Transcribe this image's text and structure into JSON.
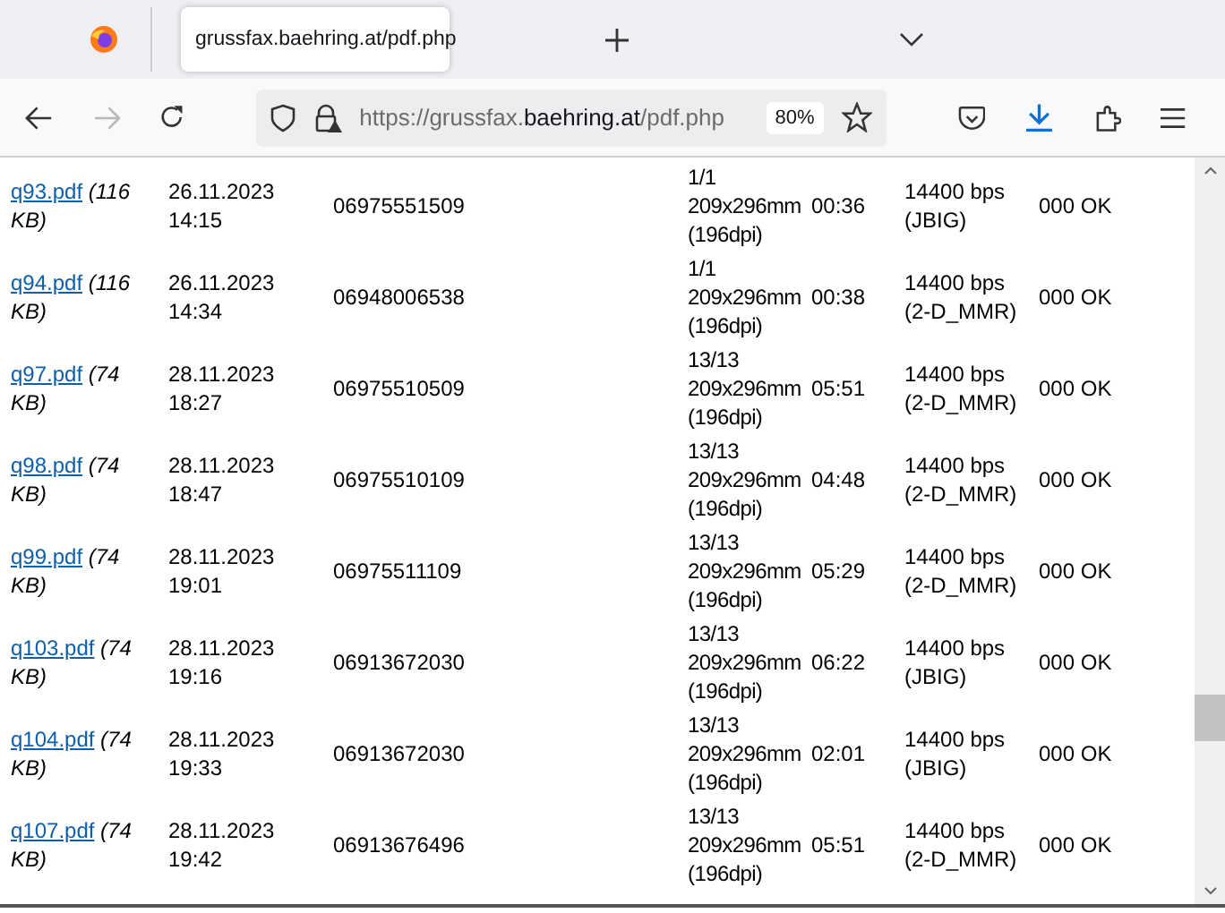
{
  "browser": {
    "tab": {
      "title": "grussfax.baehring.at/pdf.php",
      "selected": true
    },
    "url": {
      "scheme": "https://grussfax.",
      "domain": "baehring.at",
      "path": "/pdf.php"
    },
    "zoom": "80%",
    "forward_disabled": true
  },
  "rows": [
    {
      "file": "q93.pdf",
      "size": "(116 KB)",
      "date": "26.11.2023 14:15",
      "number": "06975551509",
      "pages": "1/1 209x296mm (196dpi)",
      "duration": "00:36",
      "speed": "14400 bps (JBIG)",
      "status": "000 OK"
    },
    {
      "file": "q94.pdf",
      "size": "(116 KB)",
      "date": "26.11.2023 14:34",
      "number": "06948006538",
      "pages": "1/1 209x296mm (196dpi)",
      "duration": "00:38",
      "speed": "14400 bps (2-D_MMR)",
      "status": "000 OK"
    },
    {
      "file": "q97.pdf",
      "size": "(74 KB)",
      "date": "28.11.2023 18:27",
      "number": "06975510509",
      "pages": "13/13 209x296mm (196dpi)",
      "duration": "05:51",
      "speed": "14400 bps (2-D_MMR)",
      "status": "000 OK"
    },
    {
      "file": "q98.pdf",
      "size": "(74 KB)",
      "date": "28.11.2023 18:47",
      "number": "06975510109",
      "pages": "13/13 209x296mm (196dpi)",
      "duration": "04:48",
      "speed": "14400 bps (2-D_MMR)",
      "status": "000 OK"
    },
    {
      "file": "q99.pdf",
      "size": "(74 KB)",
      "date": "28.11.2023 19:01",
      "number": "06975511109",
      "pages": "13/13 209x296mm (196dpi)",
      "duration": "05:29",
      "speed": "14400 bps (2-D_MMR)",
      "status": "000 OK"
    },
    {
      "file": "q103.pdf",
      "size": "(74 KB)",
      "date": "28.11.2023 19:16",
      "number": "06913672030",
      "pages": "13/13 209x296mm (196dpi)",
      "duration": "06:22",
      "speed": "14400 bps (JBIG)",
      "status": "000 OK"
    },
    {
      "file": "q104.pdf",
      "size": "(74 KB)",
      "date": "28.11.2023 19:33",
      "number": "06913672030",
      "pages": "13/13 209x296mm (196dpi)",
      "duration": "02:01",
      "speed": "14400 bps (JBIG)",
      "status": "000 OK"
    },
    {
      "file": "q107.pdf",
      "size": "(74 KB)",
      "date": "28.11.2023 19:42",
      "number": "06913676496",
      "pages": "13/13 209x296mm (196dpi)",
      "duration": "05:51",
      "speed": "14400 bps (2-D_MMR)",
      "status": "000 OK"
    }
  ]
}
